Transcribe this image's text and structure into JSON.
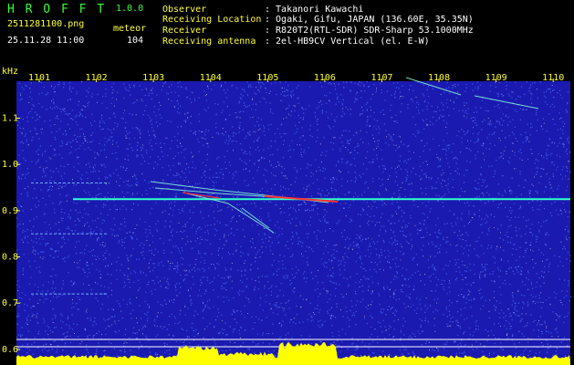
{
  "header": {
    "app_title": "H R O F F T",
    "app_version": "1.0.0",
    "filename": "2511281100.png",
    "timestamp": "25.11.28 11:00",
    "mode_label": "meteor",
    "count": "104"
  },
  "info": {
    "rows": [
      {
        "label": "Observer",
        "value": ": Takanori Kawachi"
      },
      {
        "label": "Receiving Location",
        "value": ": Ogaki, Gifu, JAPAN (136.60E, 35.35N)"
      },
      {
        "label": "Receiver",
        "value": ": R820T2(RTL-SDR) SDR-Sharp 53.1000MHz"
      },
      {
        "label": "Receiving antenna",
        "value": ": 2el-HB9CV Vertical (el. E-W)"
      }
    ]
  },
  "chart_data": {
    "type": "heatmap",
    "y_unit": "kHz",
    "y_ticks": [
      "1.1",
      "1.0",
      "0.9",
      "0.8",
      "0.7",
      "0.6"
    ],
    "y_values": [
      1.1,
      1.0,
      0.9,
      0.8,
      0.7,
      0.6
    ],
    "ylim": [
      0.58,
      1.18
    ],
    "x_ticks": [
      "1101",
      "1102",
      "1103",
      "1104",
      "1105",
      "1106",
      "1107",
      "1108",
      "1109",
      "1110"
    ],
    "x_values": [
      1101,
      1102,
      1103,
      1104,
      1105,
      1106,
      1107,
      1108,
      1109,
      1110
    ],
    "xlim": [
      1100.6,
      1110.3
    ],
    "carrier_khz": 0.925,
    "reference_lines_khz": [
      0.96,
      0.85,
      0.72
    ],
    "colors": {
      "background": "#1a1ab0",
      "noise": "#4f6fff",
      "carrier": "#33ffcc",
      "echo": "#ff3333",
      "level": "#ffff00",
      "base": "#33ccff",
      "labels": "#ffff33"
    }
  }
}
